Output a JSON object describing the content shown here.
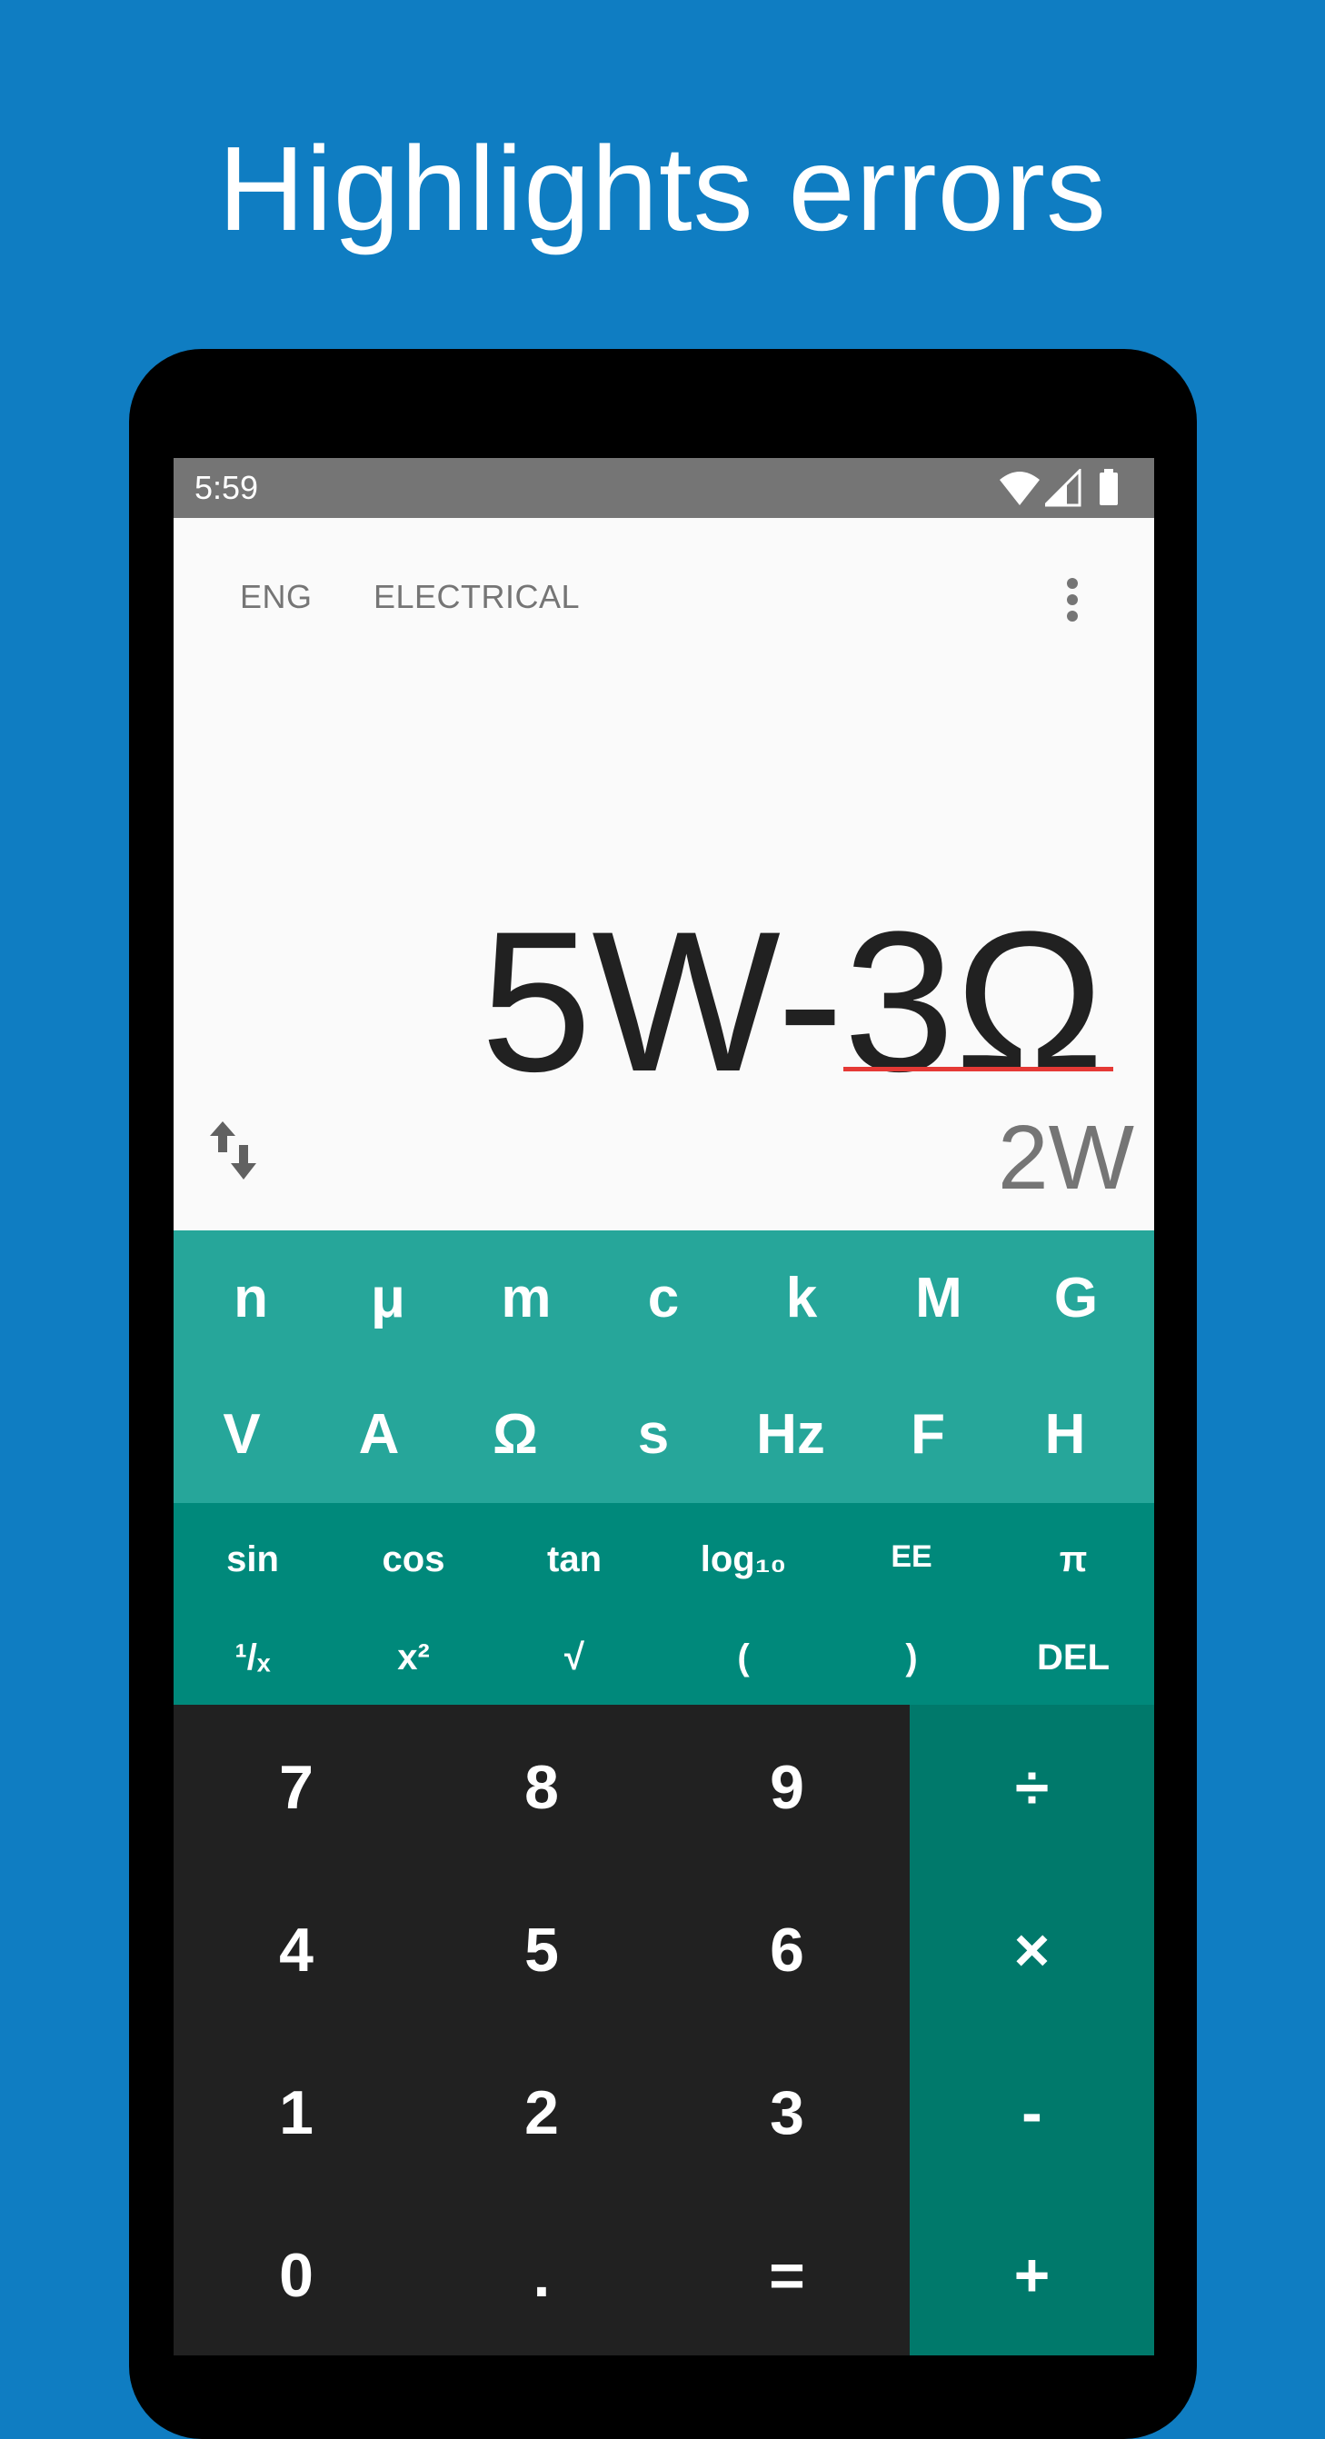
{
  "headline": "Highlights errors",
  "status_bar": {
    "time": "5:59"
  },
  "toolbar": {
    "modes": [
      "ENG",
      "ELECTRICAL"
    ],
    "more_icon": "more-vert-icon"
  },
  "display": {
    "expression_valid": "5W-",
    "expression_error": "3Ω",
    "error_underline_color": "#e53935",
    "result": "2W",
    "swap_icon": "swap-vertical-icon"
  },
  "unit_keys": {
    "prefixes": [
      "n",
      "μ",
      "m",
      "c",
      "k",
      "M",
      "G"
    ],
    "units": [
      "V",
      "A",
      "Ω",
      "s",
      "Hz",
      "F",
      "H"
    ]
  },
  "function_keys": {
    "row1": [
      "sin",
      "cos",
      "tan",
      "log₁₀",
      "EE",
      "π"
    ],
    "row2": [
      "¹/ₓ",
      "x²",
      "√",
      "(",
      ")",
      "DEL"
    ]
  },
  "number_keys": [
    "7",
    "8",
    "9",
    "4",
    "5",
    "6",
    "1",
    "2",
    "3",
    "0",
    ".",
    "="
  ],
  "operator_keys": [
    "÷",
    "×",
    "-",
    "+"
  ],
  "colors": {
    "background": "#0f7dc2",
    "units_pad": "#26a69a",
    "function_pad": "#00897b",
    "number_pad": "#212121",
    "operator_pad": "#00796b",
    "status_bar": "#757575"
  }
}
